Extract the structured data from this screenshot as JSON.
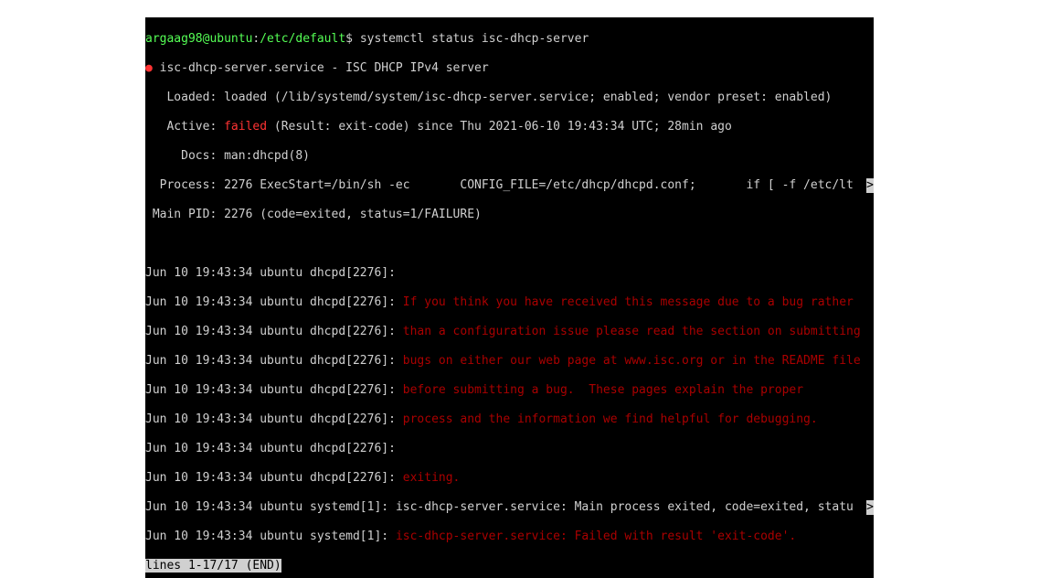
{
  "prompt": {
    "userhost": "argaag98@ubuntu",
    "path": "/etc/default",
    "symbol": "$",
    "command": "systemctl status isc-dhcp-server"
  },
  "status": {
    "bullet": "●",
    "service_line": " isc-dhcp-server.service - ISC DHCP IPv4 server",
    "loaded": "   Loaded: loaded (/lib/systemd/system/isc-dhcp-server.service; enabled; vendor preset: enabled)",
    "active_label": "   Active: ",
    "active_value": "failed",
    "active_rest": " (Result: exit-code) since Thu 2021-06-10 19:43:34 UTC; 28min ago",
    "docs": "     Docs: man:dhcpd(8)",
    "process": "  Process: 2276 ExecStart=/bin/sh -ec       CONFIG_FILE=/etc/dhcp/dhcpd.conf;       if [ -f /etc/lt",
    "mainpid": " Main PID: 2276 (code=exited, status=1/FAILURE)"
  },
  "log": {
    "prefix": "Jun 10 19:43:34 ubuntu dhcpd[2276]: ",
    "sysprefix": "Jun 10 19:43:34 ubuntu systemd[1]: ",
    "msg1": "If you think you have received this message due to a bug rather",
    "msg2": "than a configuration issue please read the section on submitting",
    "msg3": "bugs on either our web page at www.isc.org or in the README file",
    "msg4": "before submitting a bug.  These pages explain the proper",
    "msg5": "process and the information we find helpful for debugging.",
    "msg_exit": "exiting.",
    "sys1a": "isc-dhcp-server.service: Main process exited, code=exited, statu",
    "sys2a": "isc-dhcp-server.service: Failed with result 'exit-code'."
  },
  "pager": "lines 1-17/17 (END)",
  "marker": ">"
}
